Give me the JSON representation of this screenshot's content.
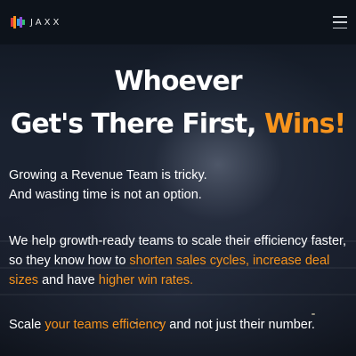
{
  "header": {
    "logo_text": "JAXX",
    "logo_icon": "jaxx-logo-mark",
    "menu_icon": "hamburger-menu-icon"
  },
  "hero": {
    "headline_line1": "Whoever",
    "headline_line2_prefix": "Get's There First, ",
    "headline_line2_accent": "Wins!",
    "paragraph1_line1": "Growing a Revenue Team is tricky.",
    "paragraph1_line2": "And wasting time is not an option.",
    "paragraph2_part1": "We help growth-ready teams to scale their efficiency faster, so they know how to ",
    "paragraph2_accent1": "shorten sales cycles, increase deal sizes",
    "paragraph2_part2": " and have ",
    "paragraph2_accent2": "higher win rates.",
    "paragraph3_part1": "Scale ",
    "paragraph3_accent": "your teams efficiency",
    "paragraph3_part2": " and not just their number."
  },
  "colors": {
    "accent": "#f7941d",
    "header_bg": "#0d131b",
    "text": "#ffffff"
  }
}
